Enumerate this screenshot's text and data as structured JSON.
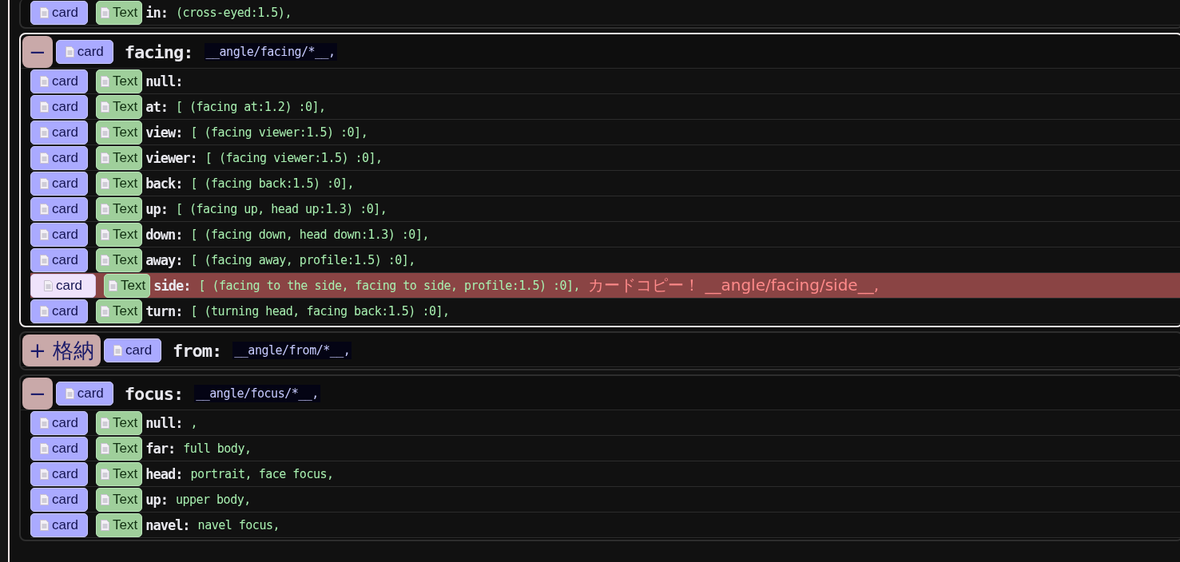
{
  "groups": [
    {
      "highlighted": false,
      "rows": [
        {
          "card": "card",
          "text": "Text",
          "key": "in:",
          "value": "(cross-eyed:1.5),",
          "selected": false
        }
      ]
    },
    {
      "highlighted": true,
      "toggle": "−",
      "card": "card",
      "key": "facing:",
      "value": "__angle/facing/*__,",
      "rows": [
        {
          "card": "card",
          "text": "Text",
          "key": "null:",
          "selected": false
        },
        {
          "card": "card",
          "text": "Text",
          "key": "at:",
          "value": "[ (facing at:1.2) :0],",
          "selected": false
        },
        {
          "card": "card",
          "text": "Text",
          "key": "view:",
          "value": "[ (facing viewer:1.5) :0],",
          "selected": false
        },
        {
          "card": "card",
          "text": "Text",
          "key": "viewer:",
          "value": "[ (facing viewer:1.5) :0],",
          "selected": false
        },
        {
          "card": "card",
          "text": "Text",
          "key": "back:",
          "value": "[ (facing back:1.5) :0],",
          "selected": false
        },
        {
          "card": "card",
          "text": "Text",
          "key": "up:",
          "value": "[ (facing up, head up:1.3) :0],",
          "selected": false
        },
        {
          "card": "card",
          "text": "Text",
          "key": "down:",
          "value": "[ (facing down, head down:1.3) :0],",
          "selected": false
        },
        {
          "card": "card",
          "text": "Text",
          "key": "away:",
          "value": "[ (facing away, profile:1.5) :0],",
          "selected": false
        },
        {
          "card": "card",
          "text": "Text",
          "key": "side:",
          "value": "[ (facing to the side, facing to side, profile:1.5) :0],",
          "selected": true,
          "message": "カードコピー！ __angle/facing/side__,"
        },
        {
          "card": "card",
          "text": "Text",
          "key": "turn:",
          "value": "[ (turning head, facing back:1.5) :0],",
          "selected": false
        }
      ]
    },
    {
      "highlighted": false,
      "toggle": "+ 格納",
      "card": "card",
      "key": "from:",
      "value": "__angle/from/*__,"
    },
    {
      "highlighted": false,
      "toggle": "−",
      "card": "card",
      "key": "focus:",
      "value": "__angle/focus/*__,",
      "rows": [
        {
          "card": "card",
          "text": "Text",
          "key": "null:",
          "value": ",",
          "selected": false
        },
        {
          "card": "card",
          "text": "Text",
          "key": "far:",
          "value": "full body,",
          "selected": false
        },
        {
          "card": "card",
          "text": "Text",
          "key": "head:",
          "value": "portrait, face focus,",
          "selected": false
        },
        {
          "card": "card",
          "text": "Text",
          "key": "up:",
          "value": "upper body,",
          "selected": false
        },
        {
          "card": "card",
          "text": "Text",
          "key": "navel:",
          "value": "navel focus,",
          "selected": false
        }
      ]
    }
  ]
}
